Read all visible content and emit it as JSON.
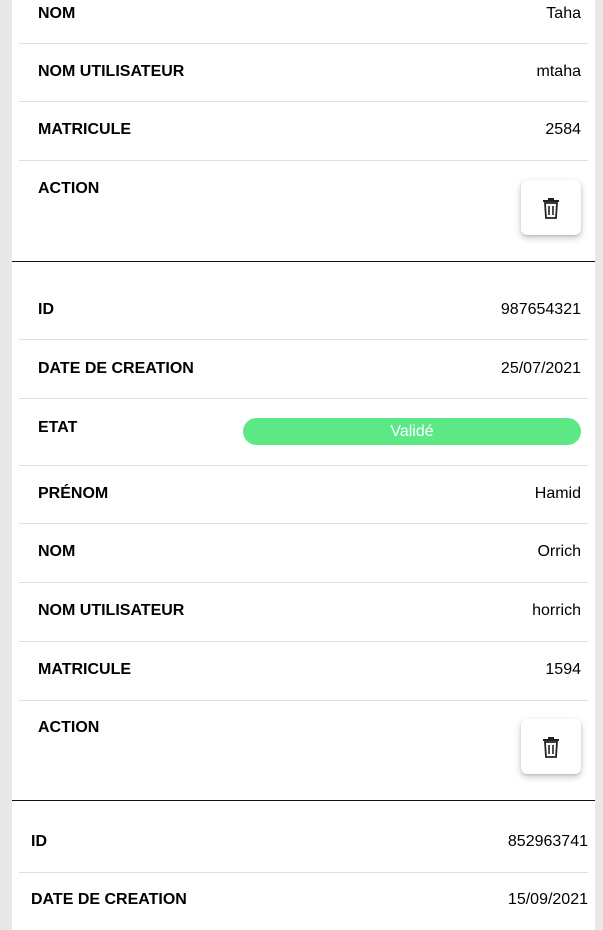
{
  "cards": [
    {
      "rows": [
        {
          "label": "NOM",
          "value": "Taha"
        },
        {
          "label": "NOM UTILISATEUR",
          "value": "mtaha"
        },
        {
          "label": "MATRICULE",
          "value": "2584"
        },
        {
          "label": "ACTION",
          "icon": "trash-icon"
        }
      ]
    },
    {
      "rows": [
        {
          "label": "ID",
          "value": "987654321"
        },
        {
          "label": "DATE DE CREATION",
          "value": "25/07/2021"
        },
        {
          "label": "ETAT",
          "badge": "Validé",
          "badge_color": "#5de886"
        },
        {
          "label": "PRÉNOM",
          "value": "Hamid"
        },
        {
          "label": "NOM",
          "value": "Orrich"
        },
        {
          "label": "NOM UTILISATEUR",
          "value": "horrich"
        },
        {
          "label": "MATRICULE",
          "value": "1594"
        },
        {
          "label": "ACTION",
          "icon": "trash-icon"
        }
      ]
    },
    {
      "rows": [
        {
          "label": "ID",
          "value": "852963741"
        },
        {
          "label": "DATE DE CREATION",
          "value": "15/09/2021"
        }
      ]
    }
  ]
}
